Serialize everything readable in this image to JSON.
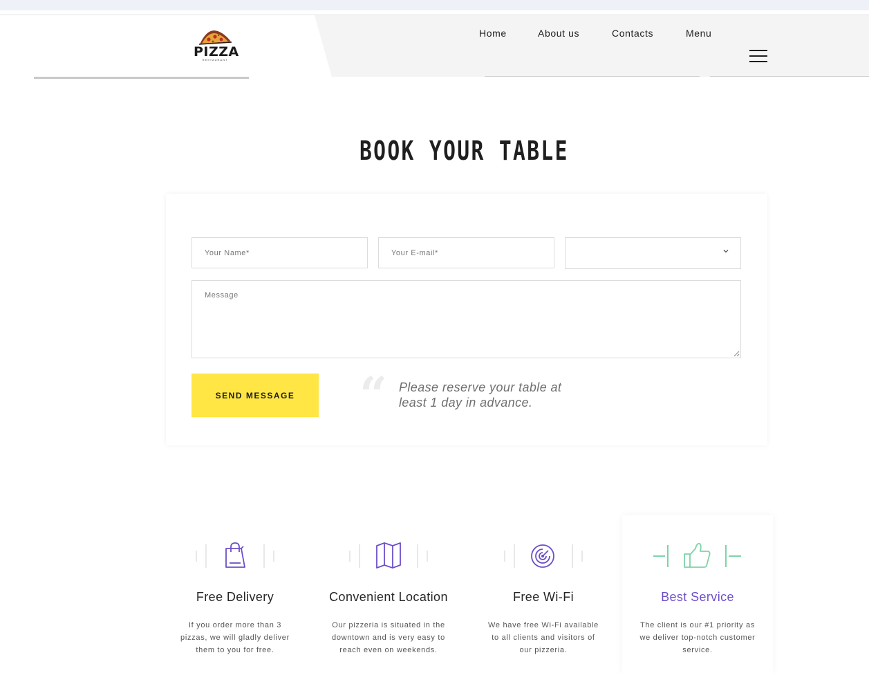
{
  "header": {
    "logo": {
      "word": "PIZZA",
      "subtitle": "RESTAURANT"
    },
    "nav": [
      {
        "label": "Home"
      },
      {
        "label": "About us"
      },
      {
        "label": "Contacts"
      },
      {
        "label": "Menu"
      }
    ],
    "menu_icon": "hamburger-icon"
  },
  "booking": {
    "title": "BOOK YOUR TABLE",
    "name_placeholder": "Your Name*",
    "email_placeholder": "Your E-mail*",
    "select_value": "",
    "message_placeholder": "Message",
    "send_label": "SEND MESSAGE",
    "quote_mark": "“",
    "quote": "Please reserve your table at least 1 day in advance."
  },
  "features": [
    {
      "icon": "shopping-bag-icon",
      "title": "Free Delivery",
      "description": "If you order more than 3 pizzas, we will gladly deliver them to you for free."
    },
    {
      "icon": "map-icon",
      "title": "Convenient Location",
      "description": "Our pizzeria is situated in the downtown and is very easy to reach even on weekends."
    },
    {
      "icon": "wifi-radar-icon",
      "title": "Free Wi-Fi",
      "description": "We have free Wi-Fi available to all clients and visitors of our pizzeria."
    },
    {
      "icon": "thumbs-up-icon",
      "title": "Best Service",
      "description": "The client is our #1 priority as we deliver top-notch customer service."
    }
  ],
  "colors": {
    "accent_yellow": "#ffe645",
    "accent_purple": "#6d4ec8",
    "accent_green": "#7dd3a8"
  }
}
